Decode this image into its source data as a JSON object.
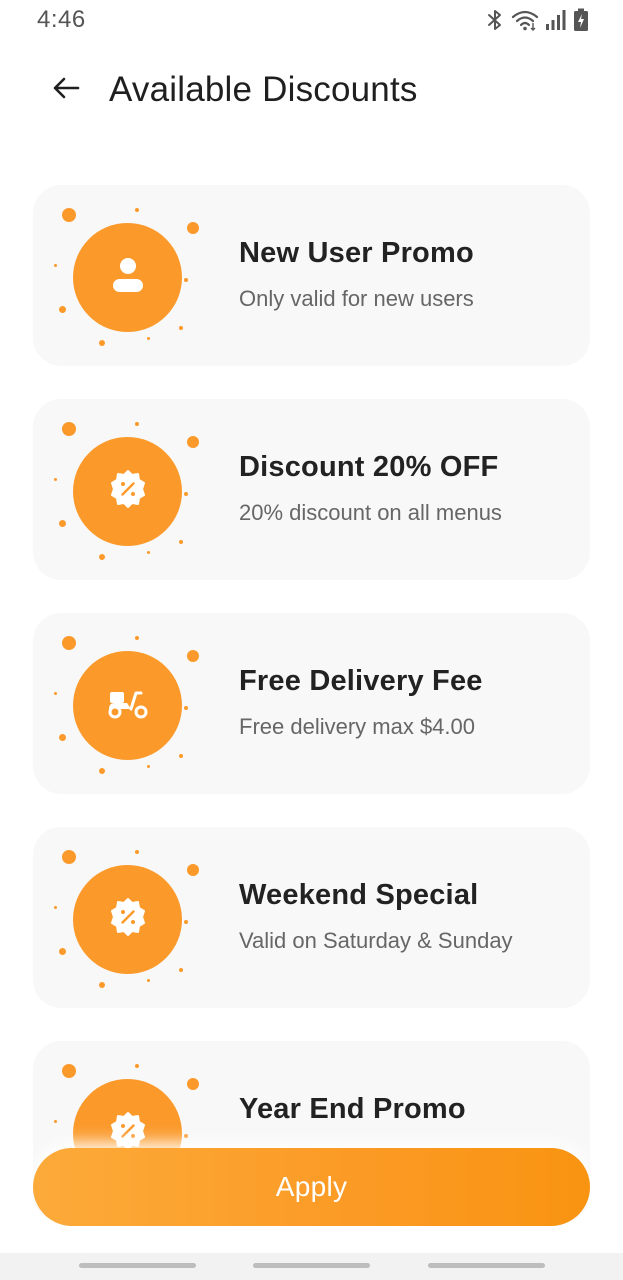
{
  "status_bar": {
    "time": "4:46",
    "icons": [
      "bluetooth-icon",
      "wifi-icon",
      "signal-icon",
      "battery-charging-icon"
    ]
  },
  "header": {
    "title": "Available Discounts",
    "back_icon": "arrow-left-icon"
  },
  "discounts": [
    {
      "title": "New User Promo",
      "subtitle": "Only valid for new users",
      "icon": "user-icon"
    },
    {
      "title": "Discount 20% OFF",
      "subtitle": "20% discount on all menus",
      "icon": "discount-badge-icon"
    },
    {
      "title": "Free Delivery Fee",
      "subtitle": "Free delivery max $4.00",
      "icon": "scooter-icon"
    },
    {
      "title": "Weekend Special",
      "subtitle": "Valid on Saturday & Sunday",
      "icon": "discount-badge-icon"
    },
    {
      "title": "Year End Promo",
      "subtitle": "",
      "icon": "discount-badge-icon"
    }
  ],
  "apply_button": {
    "label": "Apply"
  },
  "colors": {
    "accent": "#fb9a2b",
    "card_background": "#f8f8f8",
    "title_text": "#1f1f1f",
    "subtitle_text": "#666666"
  }
}
